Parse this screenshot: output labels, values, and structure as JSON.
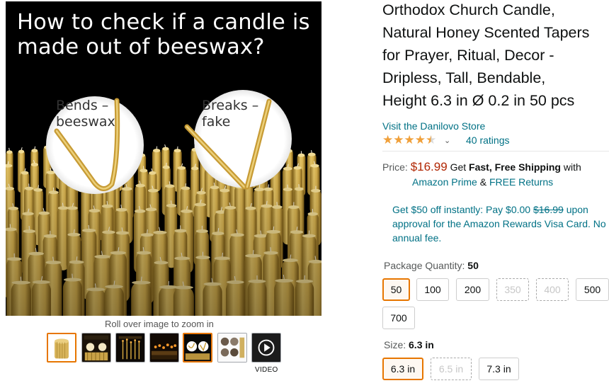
{
  "image": {
    "headline_line1": "How to check if a candle is",
    "headline_line2": "made out of beeswax?",
    "bend_label_1": "Bends –",
    "bend_label_2": "beeswax",
    "break_label_1": "Breaks –",
    "break_label_2": "fake",
    "zoom_hint": "Roll over image to zoom in",
    "video_label": "VIDEO"
  },
  "thumbnails": [
    {
      "name": "thumb-bundle",
      "active": true
    },
    {
      "name": "thumb-beeswax-check"
    },
    {
      "name": "thumb-great-for"
    },
    {
      "name": "thumb-candles-lit"
    },
    {
      "name": "thumb-bend-break"
    },
    {
      "name": "thumb-uses"
    },
    {
      "name": "thumb-video"
    }
  ],
  "product": {
    "title_lines": [
      "Orthodox Church Candle,",
      "Natural Honey Scented Tapers",
      "for Prayer, Ritual, Decor -",
      "Dripless, Tall, Bendable,",
      "Height 6.3 in Ø 0.2 in 50 pcs"
    ],
    "store_link": "Visit the Danilovo Store",
    "rating_value": 4.5,
    "ratings_count": "40 ratings"
  },
  "price": {
    "label": "Price:",
    "value": "$16.99",
    "get": "Get",
    "fast_free": "Fast, Free Shipping",
    "with": "with",
    "prime": "Amazon Prime",
    "amp": "&",
    "returns": "FREE Returns"
  },
  "promo": {
    "text_before": "Get $50 off instantly: Pay $0.00",
    "strike": "$16.99",
    "text_after": "upon approval for the Amazon Rewards Visa Card. No annual fee."
  },
  "quantity": {
    "label": "Package Quantity:",
    "selected": "50",
    "options": [
      "50",
      "100",
      "200",
      "350",
      "400",
      "500",
      "700"
    ]
  },
  "size": {
    "label": "Size:",
    "selected": "6.3 in",
    "options": [
      "6.3 in",
      "6.5 in",
      "7.3 in"
    ]
  },
  "colors": {
    "link": "#007185",
    "price": "#b12704",
    "selected_border": "#e77600",
    "star": "#f0a03a"
  }
}
